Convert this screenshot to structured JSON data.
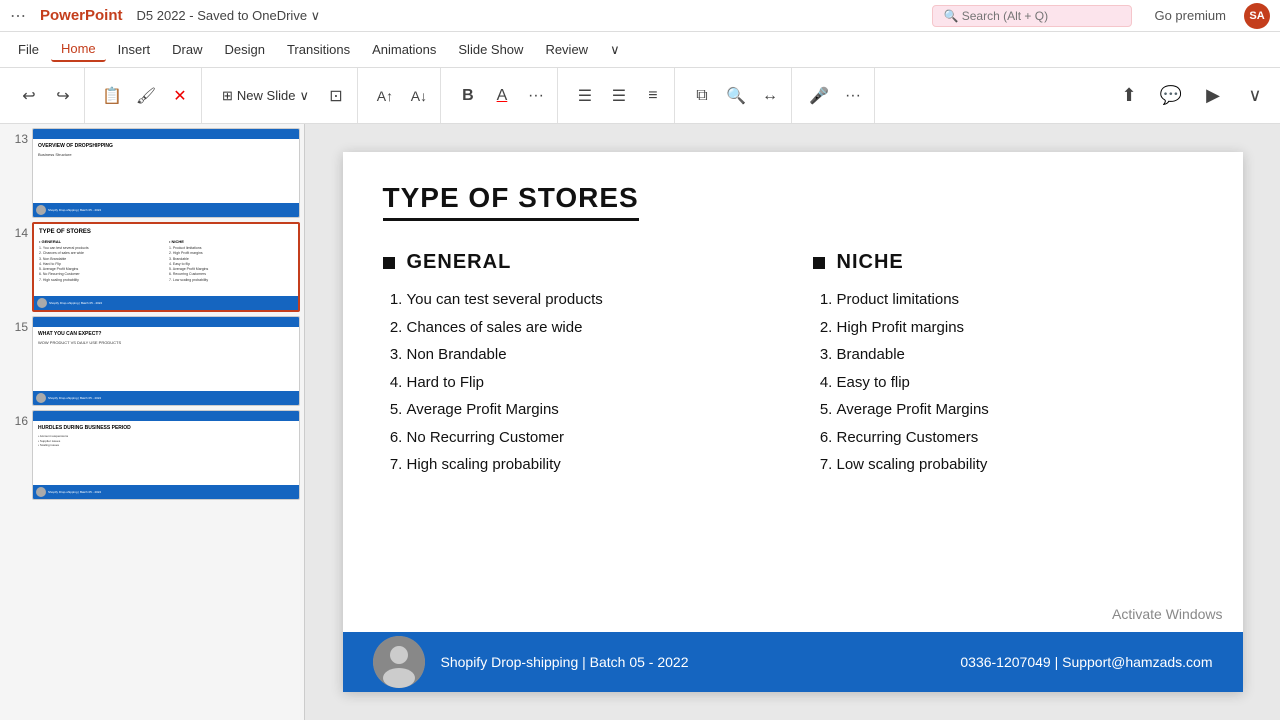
{
  "titlebar": {
    "dots": "⋯",
    "logo": "PowerPoint",
    "doc": "D5 2022 - Saved to OneDrive ∨",
    "search_placeholder": "🔍 Search (Alt + Q)",
    "premium": "Go premium",
    "avatar": "SA"
  },
  "menubar": {
    "items": [
      {
        "label": "File",
        "active": false
      },
      {
        "label": "Home",
        "active": true
      },
      {
        "label": "Insert",
        "active": false
      },
      {
        "label": "Draw",
        "active": false
      },
      {
        "label": "Design",
        "active": false
      },
      {
        "label": "Transitions",
        "active": false
      },
      {
        "label": "Animations",
        "active": false
      },
      {
        "label": "Slide Show",
        "active": false
      },
      {
        "label": "Review",
        "active": false
      },
      {
        "label": "∨",
        "active": false
      }
    ]
  },
  "ribbon": {
    "undo": "↩",
    "redo": "↪",
    "clipboard": "📋",
    "format_painter": "🖌",
    "delete": "✕",
    "new_slide_label": "New Slide",
    "layout_icon": "⊞",
    "font_increase": "A↑",
    "font_decrease": "A↓",
    "bold": "B",
    "font_color": "A",
    "more": "···",
    "bullets": "☰",
    "numbering": "☰",
    "align": "≡",
    "arrange": "⧉",
    "find": "🔍",
    "replace": "↔",
    "mic": "🎤",
    "more2": "···",
    "share": "⬆",
    "comments": "💬",
    "present": "▶",
    "more3": "∨"
  },
  "slides": [
    {
      "num": "13",
      "title": "OVERVIEW OF DROPSHIPPING",
      "subtitle": "Business Structure",
      "active": false
    },
    {
      "num": "14",
      "title": "TYPE OF STORES",
      "active": true,
      "general_items": [
        "You can test several products",
        "Chances of sales are wide",
        "Non Brandable",
        "Hard to Flip",
        "Average Profit Margins",
        "No Recurring Customer",
        "High scaling probability"
      ],
      "niche_items": [
        "Product limitations",
        "High Profit margins",
        "Brandable",
        "Easy to flip",
        "Average Profit Margins",
        "Recurring Customers",
        "Low scaling probability"
      ]
    },
    {
      "num": "15",
      "title": "WHAT YOU CAN EXPECT?",
      "subtitle": "WOW PRODUCT VS DAILY USE PRODUCTS",
      "active": false
    },
    {
      "num": "16",
      "title": "HURDLES DURING BUSINESS PERIOD",
      "active": false
    }
  ],
  "slide": {
    "title": "TYPE OF STORES",
    "general": {
      "heading": "GENERAL",
      "items": [
        "You can test several products",
        "Chances of sales are wide",
        "Non Brandable",
        "Hard to Flip",
        "Average Profit Margins",
        "No Recurring Customer",
        "High scaling probability"
      ]
    },
    "niche": {
      "heading": "NICHE",
      "items": [
        "Product limitations",
        "High Profit margins",
        "Brandable",
        "Easy to flip",
        "Average Profit Margins",
        "Recurring Customers",
        "Low scaling probability"
      ]
    },
    "footer": {
      "brand": "Shopify Drop-shipping | Batch 05 - 2022",
      "phone": "0336-1207049",
      "separator": "|",
      "email": "Support@hamzads.com"
    }
  },
  "activate_windows": "Activate Windows"
}
